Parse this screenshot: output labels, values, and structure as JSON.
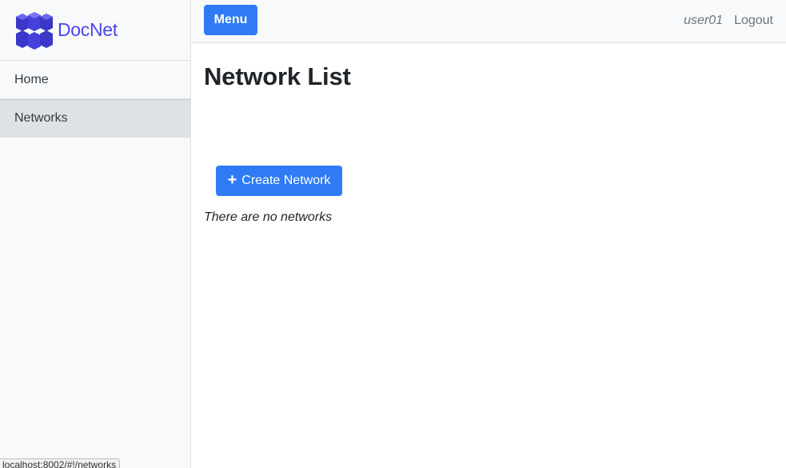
{
  "brand": {
    "name": "DocNet",
    "logo_icon": "cubes-logo-icon",
    "color": "#4a47e6"
  },
  "sidebar": {
    "items": [
      {
        "label": "Home",
        "active": false
      },
      {
        "label": "Networks",
        "active": true
      }
    ]
  },
  "topbar": {
    "menu_label": "Menu",
    "username": "user01",
    "logout_label": "Logout"
  },
  "main": {
    "title": "Network List",
    "create_button": {
      "icon": "plus-icon",
      "label": "Create Network"
    },
    "empty_message": "There are no networks"
  },
  "status_bar": {
    "url": "localhost:8002/#!/networks"
  },
  "colors": {
    "primary": "#2f7bf5",
    "sidebar_bg": "#f8f9fa",
    "active_item_bg": "#dee2e6"
  }
}
